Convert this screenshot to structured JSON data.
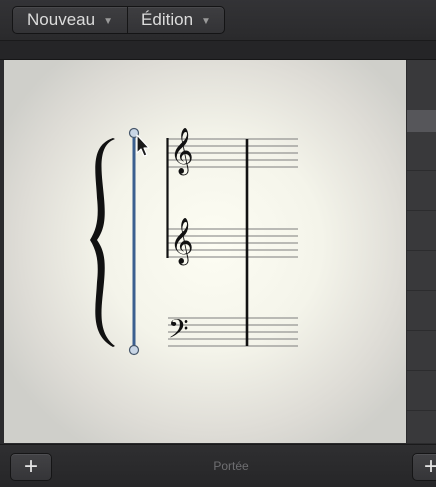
{
  "toolbar": {
    "menu_new": "Nouveau",
    "menu_edit": "Édition"
  },
  "footer": {
    "panel_label": "Portée"
  },
  "icons": {
    "caret": "triangle-down",
    "add": "plus",
    "cursor": "arrow-pointer"
  },
  "colors": {
    "selection_line": "#3b5f8f",
    "handle_fill": "#c9d6e6"
  }
}
